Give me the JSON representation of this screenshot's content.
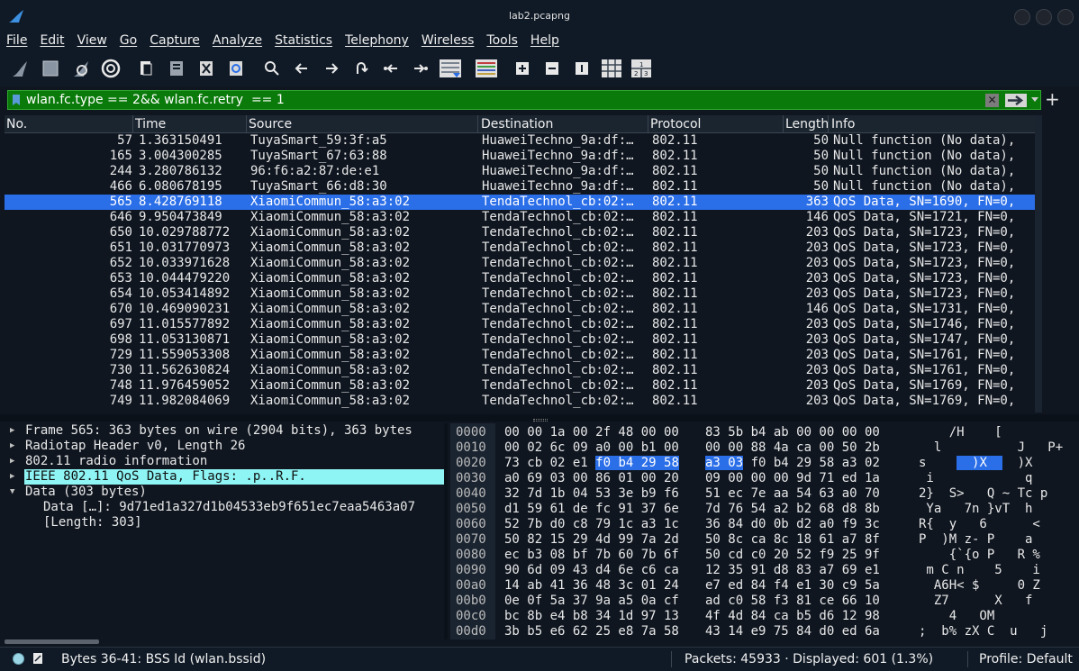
{
  "window": {
    "title": "lab2.pcapng"
  },
  "menu": [
    "File",
    "Edit",
    "View",
    "Go",
    "Capture",
    "Analyze",
    "Statistics",
    "Telephony",
    "Wireless",
    "Tools",
    "Help"
  ],
  "filter": {
    "value": "wlan.fc.type == 2&& wlan.fc.retry  == 1"
  },
  "columns": {
    "no": "No.",
    "time": "Time",
    "source": "Source",
    "destination": "Destination",
    "protocol": "Protocol",
    "length": "Length",
    "info": "Info"
  },
  "packets": [
    {
      "no": "57",
      "time": "1.363150491",
      "src": "TuyaSmart_59:3f:a5",
      "dst": "HuaweiTechno_9a:df:…",
      "proto": "802.11",
      "len": "50",
      "info": "Null function (No data),"
    },
    {
      "no": "165",
      "time": "3.004300285",
      "src": "TuyaSmart_67:63:88",
      "dst": "HuaweiTechno_9a:df:…",
      "proto": "802.11",
      "len": "50",
      "info": "Null function (No data),"
    },
    {
      "no": "244",
      "time": "3.280786132",
      "src": "96:f6:a2:87:de:e1",
      "dst": "HuaweiTechno_9a:df:…",
      "proto": "802.11",
      "len": "50",
      "info": "Null function (No data),"
    },
    {
      "no": "466",
      "time": "6.080678195",
      "src": "TuyaSmart_66:d8:30",
      "dst": "HuaweiTechno_9a:df:…",
      "proto": "802.11",
      "len": "50",
      "info": "Null function (No data),"
    },
    {
      "no": "565",
      "time": "8.428769118",
      "src": "XiaomiCommun_58:a3:02",
      "dst": "TendaTechnol_cb:02:…",
      "proto": "802.11",
      "len": "363",
      "info": "QoS Data, SN=1690, FN=0,",
      "selected": true
    },
    {
      "no": "646",
      "time": "9.950473849",
      "src": "XiaomiCommun_58:a3:02",
      "dst": "TendaTechnol_cb:02:…",
      "proto": "802.11",
      "len": "146",
      "info": "QoS Data, SN=1721, FN=0,"
    },
    {
      "no": "650",
      "time": "10.029788772",
      "src": "XiaomiCommun_58:a3:02",
      "dst": "TendaTechnol_cb:02:…",
      "proto": "802.11",
      "len": "203",
      "info": "QoS Data, SN=1723, FN=0,"
    },
    {
      "no": "651",
      "time": "10.031770973",
      "src": "XiaomiCommun_58:a3:02",
      "dst": "TendaTechnol_cb:02:…",
      "proto": "802.11",
      "len": "203",
      "info": "QoS Data, SN=1723, FN=0,"
    },
    {
      "no": "652",
      "time": "10.033971628",
      "src": "XiaomiCommun_58:a3:02",
      "dst": "TendaTechnol_cb:02:…",
      "proto": "802.11",
      "len": "203",
      "info": "QoS Data, SN=1723, FN=0,"
    },
    {
      "no": "653",
      "time": "10.044479220",
      "src": "XiaomiCommun_58:a3:02",
      "dst": "TendaTechnol_cb:02:…",
      "proto": "802.11",
      "len": "203",
      "info": "QoS Data, SN=1723, FN=0,"
    },
    {
      "no": "654",
      "time": "10.053414892",
      "src": "XiaomiCommun_58:a3:02",
      "dst": "TendaTechnol_cb:02:…",
      "proto": "802.11",
      "len": "203",
      "info": "QoS Data, SN=1723, FN=0,"
    },
    {
      "no": "670",
      "time": "10.469090231",
      "src": "XiaomiCommun_58:a3:02",
      "dst": "TendaTechnol_cb:02:…",
      "proto": "802.11",
      "len": "146",
      "info": "QoS Data, SN=1731, FN=0,"
    },
    {
      "no": "697",
      "time": "11.015577892",
      "src": "XiaomiCommun_58:a3:02",
      "dst": "TendaTechnol_cb:02:…",
      "proto": "802.11",
      "len": "203",
      "info": "QoS Data, SN=1746, FN=0,"
    },
    {
      "no": "698",
      "time": "11.053130871",
      "src": "XiaomiCommun_58:a3:02",
      "dst": "TendaTechnol_cb:02:…",
      "proto": "802.11",
      "len": "203",
      "info": "QoS Data, SN=1747, FN=0,"
    },
    {
      "no": "729",
      "time": "11.559053308",
      "src": "XiaomiCommun_58:a3:02",
      "dst": "TendaTechnol_cb:02:…",
      "proto": "802.11",
      "len": "203",
      "info": "QoS Data, SN=1761, FN=0,"
    },
    {
      "no": "730",
      "time": "11.562630824",
      "src": "XiaomiCommun_58:a3:02",
      "dst": "TendaTechnol_cb:02:…",
      "proto": "802.11",
      "len": "203",
      "info": "QoS Data, SN=1761, FN=0,"
    },
    {
      "no": "748",
      "time": "11.976459052",
      "src": "XiaomiCommun_58:a3:02",
      "dst": "TendaTechnol_cb:02:…",
      "proto": "802.11",
      "len": "203",
      "info": "QoS Data, SN=1769, FN=0,"
    },
    {
      "no": "749",
      "time": "11.982084069",
      "src": "XiaomiCommun_58:a3:02",
      "dst": "TendaTechnol_cb:02:…",
      "proto": "802.11",
      "len": "203",
      "info": "QoS Data, SN=1769, FN=0,"
    }
  ],
  "details": [
    {
      "label": "Frame 565: 363 bytes on wire (2904 bits), 363 bytes",
      "arrow": "▶"
    },
    {
      "label": "Radiotap Header v0, Length 26",
      "arrow": "▶"
    },
    {
      "label": "802.11 radio information",
      "arrow": "▶"
    },
    {
      "label": "IEEE 802.11 QoS Data, Flags: .p..R.F.",
      "arrow": "▶",
      "highlight": true
    },
    {
      "label": "Data (303 bytes)",
      "arrow": "▼"
    },
    {
      "label": "Data […]: 9d71ed1a327d1b04533eb9f651ec7eaa5463a07",
      "child": true
    },
    {
      "label": "[Length: 303]",
      "child": true
    }
  ],
  "hex": [
    {
      "off": "0000",
      "b1": "00 00 1a 00 2f 48 00 00",
      "b2": "83 5b b4 ab 00 00 00 00",
      "asc": "    /H    [        "
    },
    {
      "off": "0010",
      "b1": "00 02 6c 09 a0 00 b1 00",
      "b2": "00 00 88 4a ca 00 50 2b",
      "asc": "  l          J   P+"
    },
    {
      "off": "0020",
      "b1": "73 cb 02 e1",
      "b1h": "f0 b4 29 58",
      "b2h": "a3 03",
      "b2": " f0 b4 29 58 a3 02",
      "asc": "s    ",
      "asch": "  )X  ",
      "asc2": "  )X"
    },
    {
      "off": "0030",
      "b1": "a0 69 03 00 86 01 00 20",
      "b2": "09 00 00 00 9d 71 ed 1a",
      "asc": " i            q "
    },
    {
      "off": "0040",
      "b1": "32 7d 1b 04 53 3e b9 f6",
      "b2": "51 ec 7e aa 54 63 a0 70",
      "asc": "2}  S>   Q ~ Tc p"
    },
    {
      "off": "0050",
      "b1": "d1 59 61 de fc 91 37 6e",
      "b2": "7d 76 54 a2 b2 68 d8 8b",
      "asc": " Ya   7n }vT  h  "
    },
    {
      "off": "0060",
      "b1": "52 7b d0 c8 79 1c a3 1c",
      "b2": "36 84 d0 0b d2 a0 f9 3c",
      "asc": "R{  y   6      <"
    },
    {
      "off": "0070",
      "b1": "50 82 15 29 4d 99 7a 2d",
      "b2": "50 8c ca 8c 18 61 a7 8f",
      "asc": "P  )M z- P    a  "
    },
    {
      "off": "0080",
      "b1": "ec b3 08 bf 7b 60 7b 6f",
      "b2": "50 cd c0 20 52 f9 25 9f",
      "asc": "    {`{o P   R %"
    },
    {
      "off": "0090",
      "b1": "90 6d 09 43 d4 6e c6 ca",
      "b2": "12 35 91 d8 83 a7 69 e1",
      "asc": " m C n    5    i "
    },
    {
      "off": "00a0",
      "b1": "14 ab 41 36 48 3c 01 24",
      "b2": "e7 ed 84 f4 e1 30 c9 5a",
      "asc": "  A6H< $     0 Z"
    },
    {
      "off": "00b0",
      "b1": "0e 0f 5a 37 9a a5 0a cf",
      "b2": "ad c0 58 f3 81 ce 66 10",
      "asc": "  Z7      X   f "
    },
    {
      "off": "00c0",
      "b1": "bc 8b e4 b8 34 1d 97 13",
      "b2": "4f 4d 84 ca b5 d6 12 98",
      "asc": "    4   OM      "
    },
    {
      "off": "00d0",
      "b1": "3b b5 e6 62 25 e8 7a 58",
      "b2": "43 14 e9 75 84 d0 ed 6a",
      "asc": ";  b% zX C  u   j"
    }
  ],
  "status": {
    "field": "Bytes 36-41: BSS Id (wlan.bssid)",
    "packets": "Packets: 45933 · Displayed: 601 (1.3%)",
    "profile": "Profile: Default"
  }
}
